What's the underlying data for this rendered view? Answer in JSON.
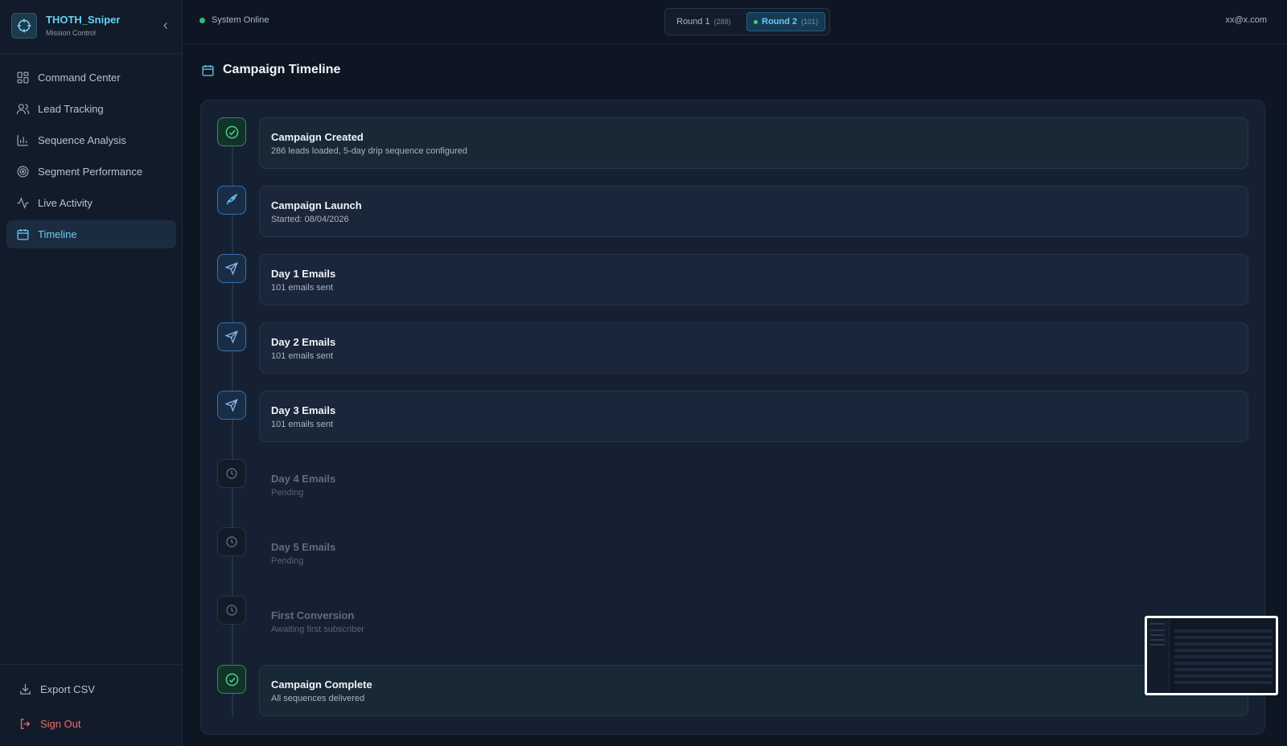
{
  "app": {
    "title": "THOTH_Sniper",
    "subtitle": "Mission Control"
  },
  "sidebar": {
    "items": [
      {
        "label": "Command Center",
        "icon": "grid-icon"
      },
      {
        "label": "Lead Tracking",
        "icon": "users-icon"
      },
      {
        "label": "Sequence Analysis",
        "icon": "bar-chart-icon"
      },
      {
        "label": "Segment Performance",
        "icon": "target-icon"
      },
      {
        "label": "Live Activity",
        "icon": "activity-icon"
      },
      {
        "label": "Timeline",
        "icon": "calendar-icon",
        "active": true
      }
    ],
    "export_label": "Export CSV",
    "signout_label": "Sign Out"
  },
  "topbar": {
    "status": "System Online",
    "rounds": [
      {
        "label": "Round 1",
        "count": "(288)"
      },
      {
        "label": "Round 2",
        "count": "(101)",
        "selected": true
      }
    ],
    "user_email": "xx@x.com"
  },
  "main": {
    "title": "Campaign Timeline",
    "events": [
      {
        "title": "Campaign Created",
        "subtitle": "286 leads loaded, 5-day drip sequence configured",
        "state": "done",
        "icon": "check-circle-icon"
      },
      {
        "title": "Campaign Launch",
        "subtitle": "Started: 08/04/2026",
        "state": "active",
        "icon": "rocket-icon"
      },
      {
        "title": "Day 1 Emails",
        "subtitle": "101 emails sent",
        "state": "active",
        "icon": "send-icon"
      },
      {
        "title": "Day 2 Emails",
        "subtitle": "101 emails sent",
        "state": "active",
        "icon": "send-icon"
      },
      {
        "title": "Day 3 Emails",
        "subtitle": "101 emails sent",
        "state": "active",
        "icon": "send-icon"
      },
      {
        "title": "Day 4 Emails",
        "subtitle": "Pending",
        "state": "pending",
        "icon": "clock-icon"
      },
      {
        "title": "Day 5 Emails",
        "subtitle": "Pending",
        "state": "pending",
        "icon": "clock-icon"
      },
      {
        "title": "First Conversion",
        "subtitle": "Awaiting first subscriber",
        "state": "pending",
        "icon": "clock-icon"
      },
      {
        "title": "Campaign Complete",
        "subtitle": "All sequences delivered",
        "state": "done",
        "icon": "check-circle-icon"
      }
    ]
  },
  "colors": {
    "accent": "#67d1f5",
    "success": "#2fbf71",
    "danger": "#ef6b70",
    "background": "#0f1623"
  }
}
